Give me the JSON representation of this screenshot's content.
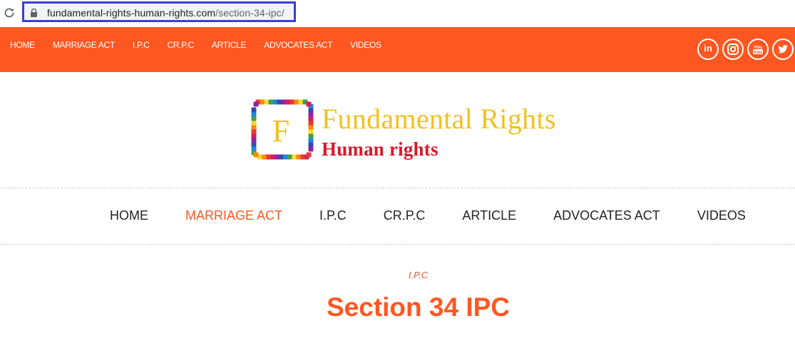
{
  "browser": {
    "url_host": "fundamental-rights-human-rights.com",
    "url_path": "/section-34-ipc/"
  },
  "top_nav": {
    "items": [
      "HOME",
      "MARRIAGE ACT",
      "I.P.C",
      "CR.P.C",
      "ARTICLE",
      "ADVOCATES ACT",
      "VIDEOS"
    ]
  },
  "social": {
    "items": [
      {
        "name": "linkedin",
        "label": "in"
      },
      {
        "name": "instagram",
        "icon": "instagram-icon"
      },
      {
        "name": "youtube",
        "icon": "youtube-icon"
      },
      {
        "name": "twitter",
        "icon": "twitter-icon"
      }
    ]
  },
  "brand": {
    "logo_letter": "F",
    "title": "Fundamental Rights",
    "subtitle": "Human rights"
  },
  "main_nav": {
    "items": [
      "HOME",
      "MARRIAGE ACT",
      "I.P.C",
      "CR.P.C",
      "ARTICLE",
      "ADVOCATES ACT",
      "VIDEOS"
    ],
    "active": "MARRIAGE ACT"
  },
  "post": {
    "category": "I.P.C",
    "title": "Section 34 IPC"
  },
  "colors": {
    "accent": "#ff5722",
    "brand_yellow": "#f3c11b",
    "brand_red": "#d7192a",
    "url_highlight": "#3b3fd1"
  }
}
